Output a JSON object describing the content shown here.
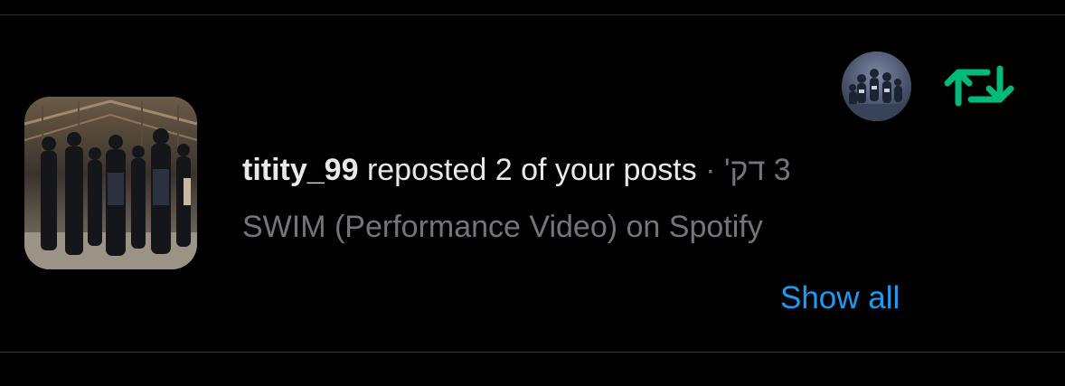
{
  "notification": {
    "username": "titity_99",
    "action": " reposted 2 of your posts",
    "separator": " · ",
    "timestamp": "3 דק'",
    "post_title": "SWIM (Performance Video) on Spotify",
    "show_all_label": "Show all"
  },
  "icons": {
    "repost": "repost-icon"
  },
  "colors": {
    "background": "#000000",
    "primary_text": "#e7e9ea",
    "secondary_text": "#71767b",
    "link": "#1d9bf0",
    "repost_green": "#00ba7c",
    "divider": "#2f3336"
  }
}
